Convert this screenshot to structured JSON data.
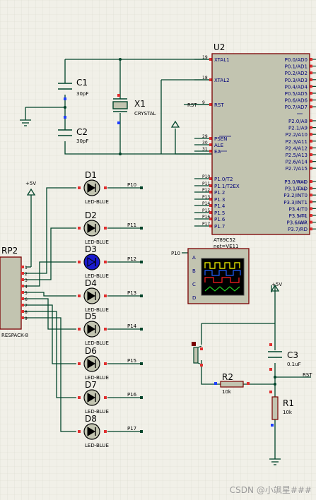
{
  "u2": {
    "ref": "U2",
    "part": "AT89C52",
    "nets": "net=VE11",
    "left_pins": [
      {
        "num": "19",
        "name": "XTAL1"
      },
      {
        "num": "18",
        "name": "XTAL2"
      },
      {
        "num": "9",
        "name": "RST"
      },
      {
        "num": "29",
        "name": "PSEN"
      },
      {
        "num": "30",
        "name": "ALE"
      },
      {
        "num": "31",
        "name": "EA"
      },
      {
        "num": "P10",
        "name": "P1.0/T2"
      },
      {
        "num": "P11",
        "name": "P1.1/T2EX"
      },
      {
        "num": "P12",
        "name": "P1.2"
      },
      {
        "num": "P13",
        "name": "P1.3"
      },
      {
        "num": "P14",
        "name": "P1.4"
      },
      {
        "num": "P15",
        "name": "P1.5"
      },
      {
        "num": "P16",
        "name": "P1.6"
      },
      {
        "num": "P17",
        "name": "P1.7"
      }
    ],
    "right_pins": [
      "P0.0/AD0",
      "P0.1/AD1",
      "P0.2/AD2",
      "P0.3/AD3",
      "P0.4/AD4",
      "P0.5/AD5",
      "P0.6/AD6",
      "P0.7/AD7",
      "P2.0/A8",
      "P2.1/A9",
      "P2.2/A10",
      "P2.3/A11",
      "P2.4/A12",
      "P2.5/A13",
      "P2.6/A14",
      "P2.7/A15",
      "P3.0/RXD",
      "P3.1/TXD",
      "P3.2/INT0",
      "P3.3/INT1",
      "P3.4/T0",
      "P3.5/T1",
      "P3.6/WR",
      "P3.7/RD"
    ]
  },
  "crystal": {
    "ref": "X1",
    "value": "CRYSTAL"
  },
  "c1": {
    "ref": "C1",
    "value": "30pF"
  },
  "c2": {
    "ref": "C2",
    "value": "30pF"
  },
  "c3": {
    "ref": "C3",
    "value": "0.1uF"
  },
  "r1": {
    "ref": "R1",
    "value": "10k"
  },
  "r2": {
    "ref": "R2",
    "value": "10k"
  },
  "rp2": {
    "ref": "RP2",
    "part": "RESPACK-8",
    "pins": [
      "1",
      "2",
      "3",
      "4",
      "5",
      "6",
      "7",
      "8",
      "9"
    ]
  },
  "power_label": "+5V",
  "rst_label": "RST",
  "p10_label": "P10",
  "scope_channels": [
    "A",
    "B",
    "C",
    "D"
  ],
  "leds": [
    {
      "ref": "D1",
      "value": "LED-BLUE",
      "net": "P10",
      "lit": false
    },
    {
      "ref": "D2",
      "value": "LED-BLUE",
      "net": "P11",
      "lit": false
    },
    {
      "ref": "D3",
      "value": "LED-BLUE",
      "net": "P12",
      "lit": true
    },
    {
      "ref": "D4",
      "value": "LED-BLUE",
      "net": "P13",
      "lit": false
    },
    {
      "ref": "D5",
      "value": "LED-BLUE",
      "net": "P14",
      "lit": false
    },
    {
      "ref": "D6",
      "value": "LED-BLUE",
      "net": "P15",
      "lit": false
    },
    {
      "ref": "D7",
      "value": "LED-BLUE",
      "net": "P16",
      "lit": false
    },
    {
      "ref": "D8",
      "value": "LED-BLUE",
      "net": "P17",
      "lit": false
    }
  ],
  "watermark": "CSDN @小飒星###",
  "colors": {
    "wire": "#00442a",
    "body": "#c2c4b0",
    "outline": "#7a0000",
    "text": "#00007a",
    "ref": "#000000",
    "pin_red": "#e03030",
    "pin_blue": "#2040ff",
    "led_lit": "#1a1acc",
    "grid": "#dcdbd0"
  }
}
